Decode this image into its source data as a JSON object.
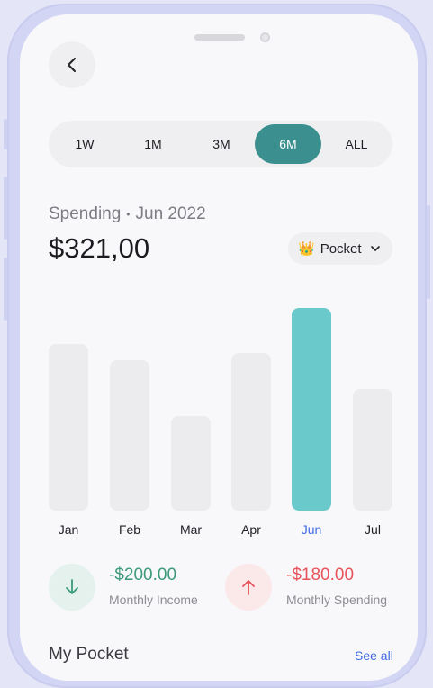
{
  "time_range": {
    "tabs": [
      "1W",
      "1M",
      "3M",
      "6M",
      "ALL"
    ],
    "selected": "6M"
  },
  "spending": {
    "label": "Spending",
    "date": "Jun 2022",
    "amount": "$321,00"
  },
  "pocket_select": {
    "emoji": "👑",
    "label": "Pocket"
  },
  "chart_data": {
    "type": "bar",
    "categories": [
      "Jan",
      "Feb",
      "Mar",
      "Apr",
      "Jun",
      "Jul"
    ],
    "values": [
      74,
      67,
      42,
      70,
      90,
      54
    ],
    "highlighted": "Jun",
    "ylim": [
      0,
      100
    ],
    "grid": false,
    "colors": {
      "default": "#ececee",
      "highlight": "#69c9cb",
      "highlight_label": "#3f6ae3"
    }
  },
  "summary": {
    "income": {
      "value": "-$200.00",
      "label": "Monthly Income",
      "color": "#3c9a79",
      "icon": "arrow-down-icon"
    },
    "spending": {
      "value": "-$180.00",
      "label": "Monthly Spending",
      "color": "#e8525a",
      "icon": "arrow-up-icon"
    }
  },
  "my_pocket": {
    "title": "My Pocket",
    "see_all": "See all"
  }
}
